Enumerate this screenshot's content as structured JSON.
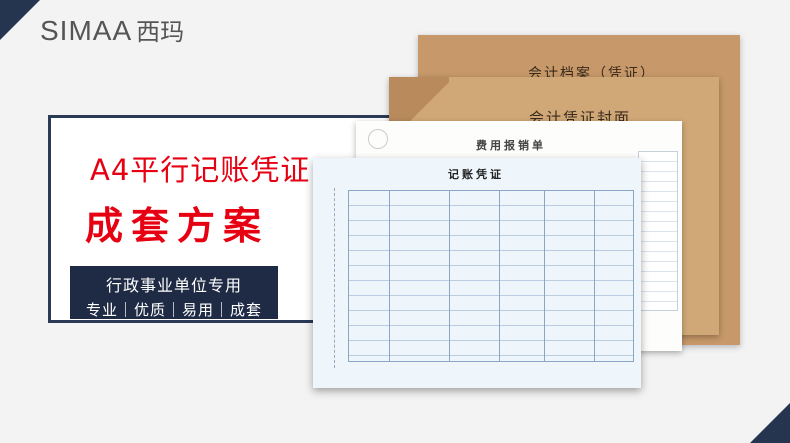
{
  "brand": {
    "latin": "SIMAA",
    "chinese": "西玛"
  },
  "hero": {
    "title_line_1": "A4平行记账凭证",
    "title_line_2": "成套方案"
  },
  "badge": {
    "line_1": "行政事业单位专用",
    "line_2": "专业｜优质｜易用｜成套"
  },
  "documents": {
    "archive_cover": "会计档案（凭证）",
    "voucher_cover": "会计凭证封面",
    "expense_form": "费用报销单",
    "voucher": "记账凭证"
  },
  "colors": {
    "accent_red": "#e60012",
    "navy": "#25354f",
    "kraft": "#c7996a"
  }
}
